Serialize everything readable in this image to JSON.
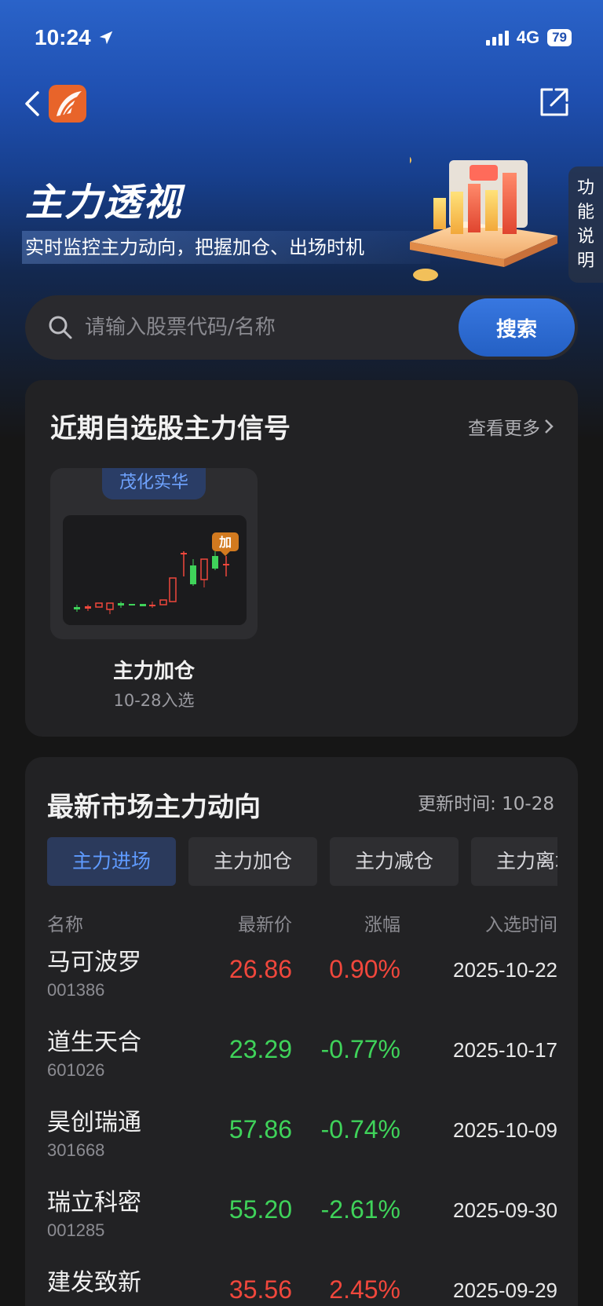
{
  "status": {
    "time": "10:24",
    "network": "4G",
    "battery": "79"
  },
  "hero": {
    "title": "主力透视",
    "subtitle": "实时监控主力动向，把握加仓、出场时机",
    "side_tab": [
      "功",
      "能",
      "说",
      "明"
    ]
  },
  "search": {
    "placeholder": "请输入股票代码/名称",
    "button_label": "搜索"
  },
  "signals": {
    "title": "近期自选股主力信号",
    "see_more": "查看更多",
    "items": [
      {
        "stock": "茂化实华",
        "badge": "加",
        "signal": "主力加仓",
        "date": "10-28入选"
      }
    ]
  },
  "market": {
    "title": "最新市场主力动向",
    "update_time": "更新时间: 10-28",
    "tabs": [
      "主力进场",
      "主力加仓",
      "主力减仓",
      "主力离场"
    ],
    "columns": {
      "name": "名称",
      "price": "最新价",
      "change": "涨幅",
      "date": "入选时间"
    },
    "rows": [
      {
        "name": "马可波罗",
        "code": "001386",
        "price": "26.86",
        "change": "0.90%",
        "date": "2025-10-22",
        "dir": "up"
      },
      {
        "name": "道生天合",
        "code": "601026",
        "price": "23.29",
        "change": "-0.77%",
        "date": "2025-10-17",
        "dir": "down"
      },
      {
        "name": "昊创瑞通",
        "code": "301668",
        "price": "57.86",
        "change": "-0.74%",
        "date": "2025-10-09",
        "dir": "down"
      },
      {
        "name": "瑞立科密",
        "code": "001285",
        "price": "55.20",
        "change": "-2.61%",
        "date": "2025-09-30",
        "dir": "down"
      },
      {
        "name": "建发致新",
        "code": "",
        "price": "35.56",
        "change": "2.45%",
        "date": "2025-09-29",
        "dir": "up"
      }
    ]
  },
  "colors": {
    "up": "#f0473c",
    "down": "#3fd35a",
    "accent": "#2f6fdc",
    "brand": "#e8642a"
  },
  "icons": [
    "back-arrow-icon",
    "app-logo-icon",
    "share-icon",
    "search-icon",
    "chevron-right-icon",
    "location-arrow-icon"
  ]
}
